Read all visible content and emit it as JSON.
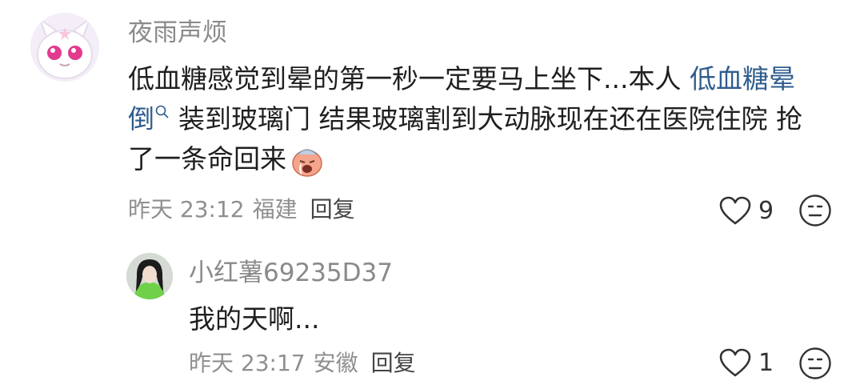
{
  "comment": {
    "username": "夜雨声烦",
    "text_before": "低血糖感觉到晕的第一秒一定要马上坐下...本人 ",
    "topic": "低血糖晕倒",
    "text_after": "装到玻璃门 结果玻璃割到大动脉现在还在医院住院 抢了一条命回来",
    "emoji": "crying-face-emoji",
    "time": "昨天 23:12",
    "location": "福建",
    "reply_label": "回复",
    "likes": "9"
  },
  "reply": {
    "username": "小红薯69235D37",
    "text": "我的天啊...",
    "time": "昨天 23:17",
    "location": "安徽",
    "reply_label": "回复",
    "likes": "1"
  }
}
